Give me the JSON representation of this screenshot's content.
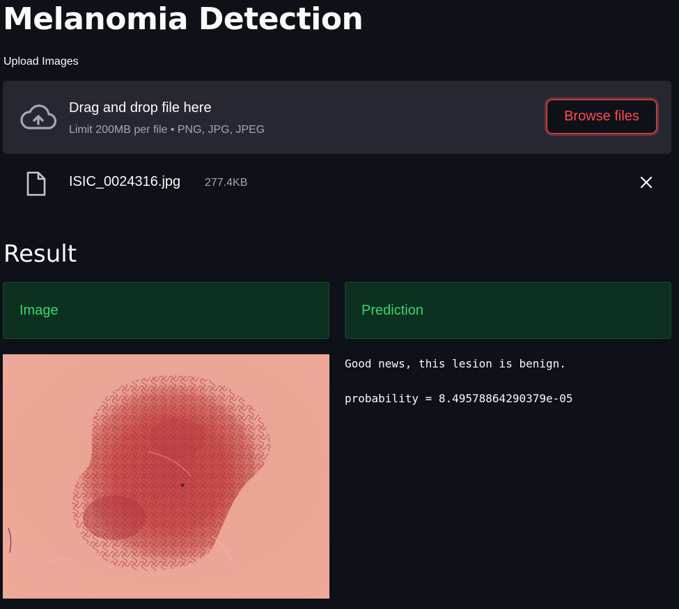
{
  "page": {
    "title": "Melanomia Detection"
  },
  "uploader": {
    "label": "Upload Images",
    "drop_title": "Drag and drop file here",
    "drop_limit": "Limit 200MB per file • PNG, JPG, JPEG",
    "browse_label": "Browse files",
    "icon": "cloud-upload-icon"
  },
  "uploaded_file": {
    "name": "ISIC_0024316.jpg",
    "size": "277.4KB",
    "icon": "file-icon",
    "remove_icon": "close-icon"
  },
  "result": {
    "heading": "Result",
    "columns": {
      "image_header": "Image",
      "prediction_header": "Prediction"
    },
    "prediction_message": "Good news, this lesion is benign.",
    "probability_line": "probability = 8.49578864290379e-05"
  },
  "colors": {
    "background": "#0e1117",
    "panel": "#262730",
    "accent": "#ff4b4b",
    "success_bg": "#0d3121",
    "success_text": "#3dd56d"
  }
}
